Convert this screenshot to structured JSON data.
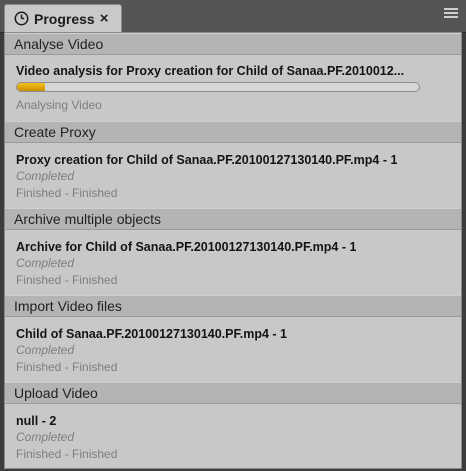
{
  "tab": {
    "title": "Progress",
    "close_glyph": "×",
    "icon": "clock-icon"
  },
  "menu_icon": "hamburger-menu-icon",
  "colors": {
    "progress_fill": "#e2aa0a",
    "header_bg": "#b4b4b4",
    "panel_bg": "#c8c8c8"
  },
  "sections": [
    {
      "header": "Analyse Video",
      "job": {
        "title": "Video analysis for Proxy creation for Child of Sanaa.PF.2010012...",
        "progress": 0.07,
        "detail": "Analysing Video"
      }
    },
    {
      "header": "Create Proxy",
      "job": {
        "title": "Proxy creation for Child of Sanaa.PF.20100127130140.PF.mp4 - 1",
        "status": "Completed",
        "detail": "Finished - Finished"
      }
    },
    {
      "header": "Archive multiple objects",
      "job": {
        "title": "Archive for Child of Sanaa.PF.20100127130140.PF.mp4 - 1",
        "status": "Completed",
        "detail": "Finished - Finished"
      }
    },
    {
      "header": "Import Video files",
      "job": {
        "title": "Child of Sanaa.PF.20100127130140.PF.mp4 - 1",
        "status": "Completed",
        "detail": "Finished - Finished"
      }
    },
    {
      "header": "Upload Video",
      "job": {
        "title": "null - 2",
        "status": "Completed",
        "detail": "Finished - Finished"
      }
    }
  ]
}
